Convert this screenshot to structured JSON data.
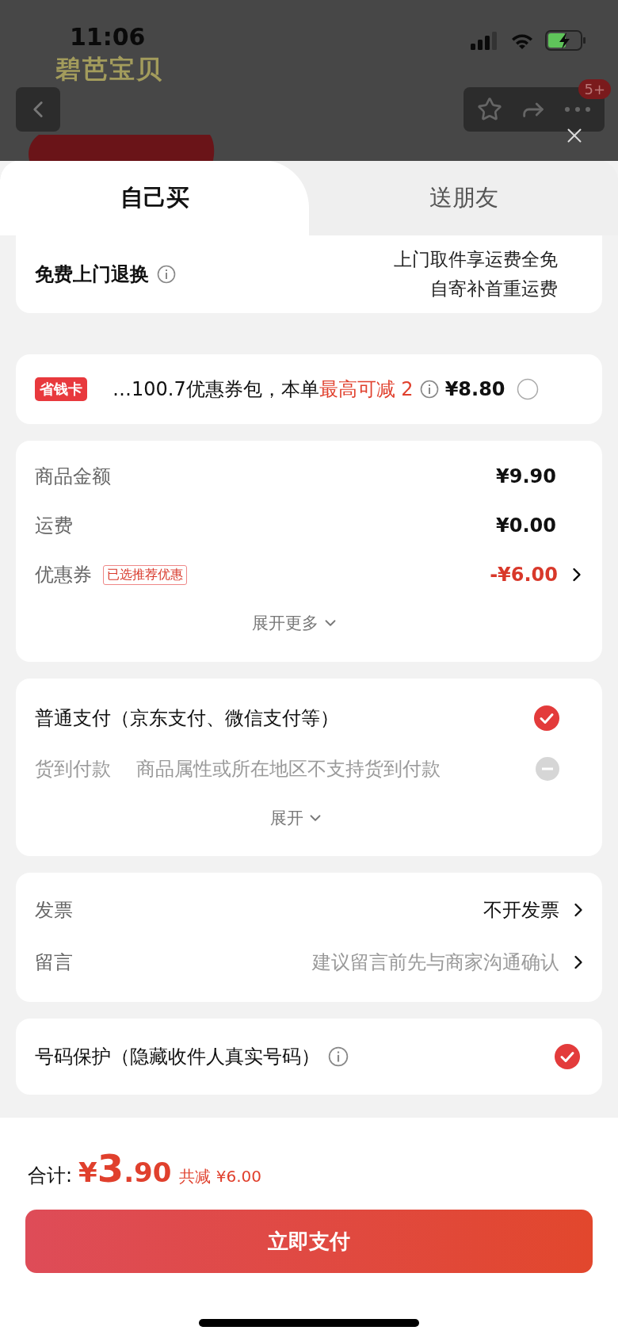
{
  "status_bar": {
    "time": "11:06"
  },
  "background": {
    "logo": "碧芭宝贝",
    "badge": "5+"
  },
  "tabs": [
    {
      "label": "自己买",
      "selected": true
    },
    {
      "label": "送朋友",
      "selected": false
    }
  ],
  "return_service": {
    "title": "免费上门退换",
    "lines": [
      "上门取件享运费全免",
      "自寄补首重运费"
    ]
  },
  "savings_card": {
    "tag": "省钱卡",
    "text": "…100.7优惠券包，本单",
    "highlight": "最高可减 2",
    "price": "¥8.80",
    "checked": false
  },
  "summary": {
    "rows": [
      {
        "label": "商品金额",
        "value": "¥9.90",
        "kind": "plain"
      },
      {
        "label": "运费",
        "value": "¥0.00",
        "kind": "plain"
      },
      {
        "label": "优惠券",
        "tag": "已选推荐优惠",
        "value": "-¥6.00",
        "kind": "discount"
      }
    ],
    "more": "展开更多"
  },
  "payment": {
    "options": [
      {
        "label": "普通支付（京东支付、微信支付等）",
        "selected": true,
        "disabled": false
      },
      {
        "label": "货到付款",
        "note": "商品属性或所在地区不支持货到付款",
        "selected": false,
        "disabled": true
      }
    ],
    "more": "展开"
  },
  "extras": [
    {
      "label": "发票",
      "value": "不开发票",
      "kind": "value"
    },
    {
      "label": "留言",
      "value": "建议留言前先与商家沟通确认",
      "kind": "hint"
    }
  ],
  "privacy": {
    "label": "号码保护（隐藏收件人真实号码）",
    "checked": true
  },
  "footer": {
    "total_label": "合计:",
    "currency": "¥",
    "integer": "3",
    "decimal": ".90",
    "saved": "共减 ¥6.00",
    "pay_button": "立即支付"
  }
}
